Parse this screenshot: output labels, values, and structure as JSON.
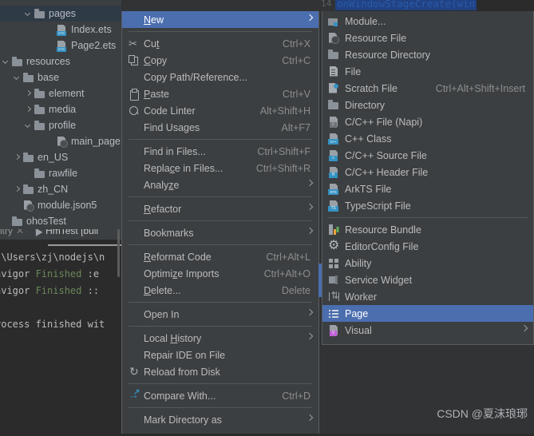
{
  "app": {
    "theme_bg": "#3c3f41",
    "menu_bg": "#3c3f41",
    "highlight_color": "#4b6eaf",
    "text_color": "#bbbbbb",
    "console_bg": "#2b2b2b"
  },
  "editor": {
    "visible_code": "onWindowStageCreate(win",
    "line_number": "14"
  },
  "project_tree": {
    "items": [
      {
        "label": "pages",
        "indent": 2,
        "arrow": "down",
        "icon": "folder-icon",
        "selected": true
      },
      {
        "label": "Index.ets",
        "indent": 4,
        "arrow": "none",
        "icon": "ets-file-icon",
        "selected": false
      },
      {
        "label": "Page2.ets",
        "indent": 4,
        "arrow": "none",
        "icon": "ets-file-icon",
        "selected": false
      },
      {
        "label": "resources",
        "indent": 0,
        "arrow": "down",
        "icon": "folder-icon",
        "selected": false
      },
      {
        "label": "base",
        "indent": 1,
        "arrow": "down",
        "icon": "folder-icon",
        "selected": false
      },
      {
        "label": "element",
        "indent": 2,
        "arrow": "right",
        "icon": "folder-icon",
        "selected": false
      },
      {
        "label": "media",
        "indent": 2,
        "arrow": "right",
        "icon": "folder-icon",
        "selected": false
      },
      {
        "label": "profile",
        "indent": 2,
        "arrow": "down",
        "icon": "folder-icon",
        "selected": false
      },
      {
        "label": "main_page",
        "indent": 4,
        "arrow": "none",
        "icon": "json-file-icon",
        "selected": false
      },
      {
        "label": "en_US",
        "indent": 1,
        "arrow": "right",
        "icon": "folder-icon",
        "selected": false
      },
      {
        "label": "rawfile",
        "indent": 2,
        "arrow": "none",
        "icon": "folder-icon",
        "selected": false
      },
      {
        "label": "zh_CN",
        "indent": 1,
        "arrow": "right",
        "icon": "folder-icon",
        "selected": false
      },
      {
        "label": "module.json5",
        "indent": 1,
        "arrow": "none",
        "icon": "json-file-icon",
        "selected": false
      },
      {
        "label": "ohosTest",
        "indent": 0,
        "arrow": "none",
        "icon": "folder-icon",
        "selected": false
      }
    ]
  },
  "console": {
    "tabs": [
      {
        "label": "ntry",
        "active": false,
        "has_close": true
      },
      {
        "label": "HmTest [buil",
        "active": true,
        "has_close": false
      }
    ],
    "lines": [
      {
        "text": ":\\Users\\zj\\nodejs\\n",
        "color": "gray"
      },
      {
        "prefix": " hvigor ",
        "status": "Finished",
        "suffix": " :e",
        "color": "green"
      },
      {
        "prefix": " hvigor ",
        "status": "Finished",
        "suffix": " ::",
        "color": "green"
      },
      {
        "text": "rocess finished wit",
        "color": "gray"
      }
    ]
  },
  "context_menu": {
    "groups": [
      {
        "items": [
          {
            "label": "New",
            "mnemonic": "N",
            "icon": null,
            "shortcut": "",
            "submenu": true,
            "highlight": true
          }
        ]
      },
      {
        "items": [
          {
            "label": "Cut",
            "mnemonic": "t",
            "icon": "cut-icon",
            "shortcut": "Ctrl+X",
            "submenu": false,
            "highlight": false
          },
          {
            "label": "Copy",
            "mnemonic": "C",
            "icon": "copy-icon",
            "shortcut": "Ctrl+C",
            "submenu": false,
            "highlight": false
          },
          {
            "label": "Copy Path/Reference...",
            "mnemonic": "",
            "icon": null,
            "shortcut": "",
            "submenu": false,
            "highlight": false
          },
          {
            "label": "Paste",
            "mnemonic": "P",
            "icon": "paste-icon",
            "shortcut": "Ctrl+V",
            "submenu": false,
            "highlight": false
          },
          {
            "label": "Code Linter",
            "mnemonic": "",
            "icon": "code-linter-icon",
            "shortcut": "Alt+Shift+H",
            "submenu": false,
            "highlight": false
          },
          {
            "label": "Find Usages",
            "mnemonic": "",
            "icon": null,
            "shortcut": "Alt+F7",
            "submenu": false,
            "highlight": false
          }
        ]
      },
      {
        "items": [
          {
            "label": "Find in Files...",
            "mnemonic": "",
            "icon": null,
            "shortcut": "Ctrl+Shift+F",
            "submenu": false,
            "highlight": false
          },
          {
            "label": "Replace in Files...",
            "mnemonic": "c",
            "icon": null,
            "shortcut": "Ctrl+Shift+R",
            "submenu": false,
            "highlight": false
          },
          {
            "label": "Analyze",
            "mnemonic": "z",
            "icon": null,
            "shortcut": "",
            "submenu": true,
            "highlight": false
          }
        ]
      },
      {
        "items": [
          {
            "label": "Refactor",
            "mnemonic": "R",
            "icon": null,
            "shortcut": "",
            "submenu": true,
            "highlight": false
          }
        ]
      },
      {
        "items": [
          {
            "label": "Bookmarks",
            "mnemonic": "",
            "icon": null,
            "shortcut": "",
            "submenu": true,
            "highlight": false
          }
        ]
      },
      {
        "items": [
          {
            "label": "Reformat Code",
            "mnemonic": "R",
            "icon": null,
            "shortcut": "Ctrl+Alt+L",
            "submenu": false,
            "highlight": false
          },
          {
            "label": "Optimize Imports",
            "mnemonic": "z",
            "icon": null,
            "shortcut": "Ctrl+Alt+O",
            "submenu": false,
            "highlight": false
          },
          {
            "label": "Delete...",
            "mnemonic": "D",
            "icon": null,
            "shortcut": "Delete",
            "submenu": false,
            "highlight": false
          }
        ]
      },
      {
        "items": [
          {
            "label": "Open In",
            "mnemonic": "",
            "icon": null,
            "shortcut": "",
            "submenu": true,
            "highlight": false
          }
        ]
      },
      {
        "items": [
          {
            "label": "Local History",
            "mnemonic": "H",
            "icon": null,
            "shortcut": "",
            "submenu": true,
            "highlight": false
          },
          {
            "label": "Repair IDE on File",
            "mnemonic": "",
            "icon": null,
            "shortcut": "",
            "submenu": false,
            "highlight": false
          },
          {
            "label": "Reload from Disk",
            "mnemonic": "",
            "icon": "reload-icon",
            "shortcut": "",
            "submenu": false,
            "highlight": false
          }
        ]
      },
      {
        "items": [
          {
            "label": "Compare With...",
            "mnemonic": "",
            "icon": "compare-icon",
            "shortcut": "Ctrl+D",
            "submenu": false,
            "highlight": false
          }
        ]
      },
      {
        "items": [
          {
            "label": "Mark Directory as",
            "mnemonic": "",
            "icon": null,
            "shortcut": "",
            "submenu": true,
            "highlight": false
          }
        ]
      }
    ]
  },
  "new_submenu": {
    "groups": [
      {
        "items": [
          {
            "label": "Module...",
            "icon": "module-icon",
            "shortcut": "",
            "submenu": false,
            "highlight": false
          },
          {
            "label": "Resource File",
            "icon": "resource-file-icon",
            "shortcut": "",
            "submenu": false,
            "highlight": false
          },
          {
            "label": "Resource Directory",
            "icon": "folder-icon",
            "shortcut": "",
            "submenu": false,
            "highlight": false
          },
          {
            "label": "File",
            "icon": "file-icon",
            "shortcut": "",
            "submenu": false,
            "highlight": false
          },
          {
            "label": "Scratch File",
            "icon": "scratch-file-icon",
            "shortcut": "Ctrl+Alt+Shift+Insert",
            "submenu": false,
            "highlight": false
          },
          {
            "label": "Directory",
            "icon": "folder-icon",
            "shortcut": "",
            "submenu": false,
            "highlight": false
          },
          {
            "label": "C/C++ File (Napi)",
            "icon": "c-file-icon",
            "shortcut": "",
            "submenu": false,
            "highlight": false
          },
          {
            "label": "C++ Class",
            "icon": "cpp-class-icon",
            "shortcut": "",
            "submenu": false,
            "highlight": false
          },
          {
            "label": "C/C++ Source File",
            "icon": "c-source-icon",
            "shortcut": "",
            "submenu": false,
            "highlight": false
          },
          {
            "label": "C/C++ Header File",
            "icon": "c-header-icon",
            "shortcut": "",
            "submenu": false,
            "highlight": false
          },
          {
            "label": "ArkTS File",
            "icon": "arkts-file-icon",
            "shortcut": "",
            "submenu": false,
            "highlight": false
          },
          {
            "label": "TypeScript File",
            "icon": "typescript-file-icon",
            "shortcut": "",
            "submenu": false,
            "highlight": false
          }
        ]
      },
      {
        "items": [
          {
            "label": "Resource Bundle",
            "icon": "resource-bundle-icon",
            "shortcut": "",
            "submenu": false,
            "highlight": false
          },
          {
            "label": "EditorConfig File",
            "icon": "gear-icon",
            "shortcut": "",
            "submenu": false,
            "highlight": false
          },
          {
            "label": "Ability",
            "icon": "ability-icon",
            "shortcut": "",
            "submenu": false,
            "highlight": false
          },
          {
            "label": "Service Widget",
            "icon": "service-widget-icon",
            "shortcut": "",
            "submenu": false,
            "highlight": false
          },
          {
            "label": "Worker",
            "icon": "worker-icon",
            "shortcut": "",
            "submenu": false,
            "highlight": false
          },
          {
            "label": "Page",
            "icon": "page-icon",
            "shortcut": "",
            "submenu": false,
            "highlight": true
          },
          {
            "label": "Visual",
            "icon": "visual-icon",
            "shortcut": "",
            "submenu": true,
            "highlight": false
          }
        ]
      }
    ]
  },
  "watermark": {
    "text": "CSDN @夏沫琅琊"
  }
}
